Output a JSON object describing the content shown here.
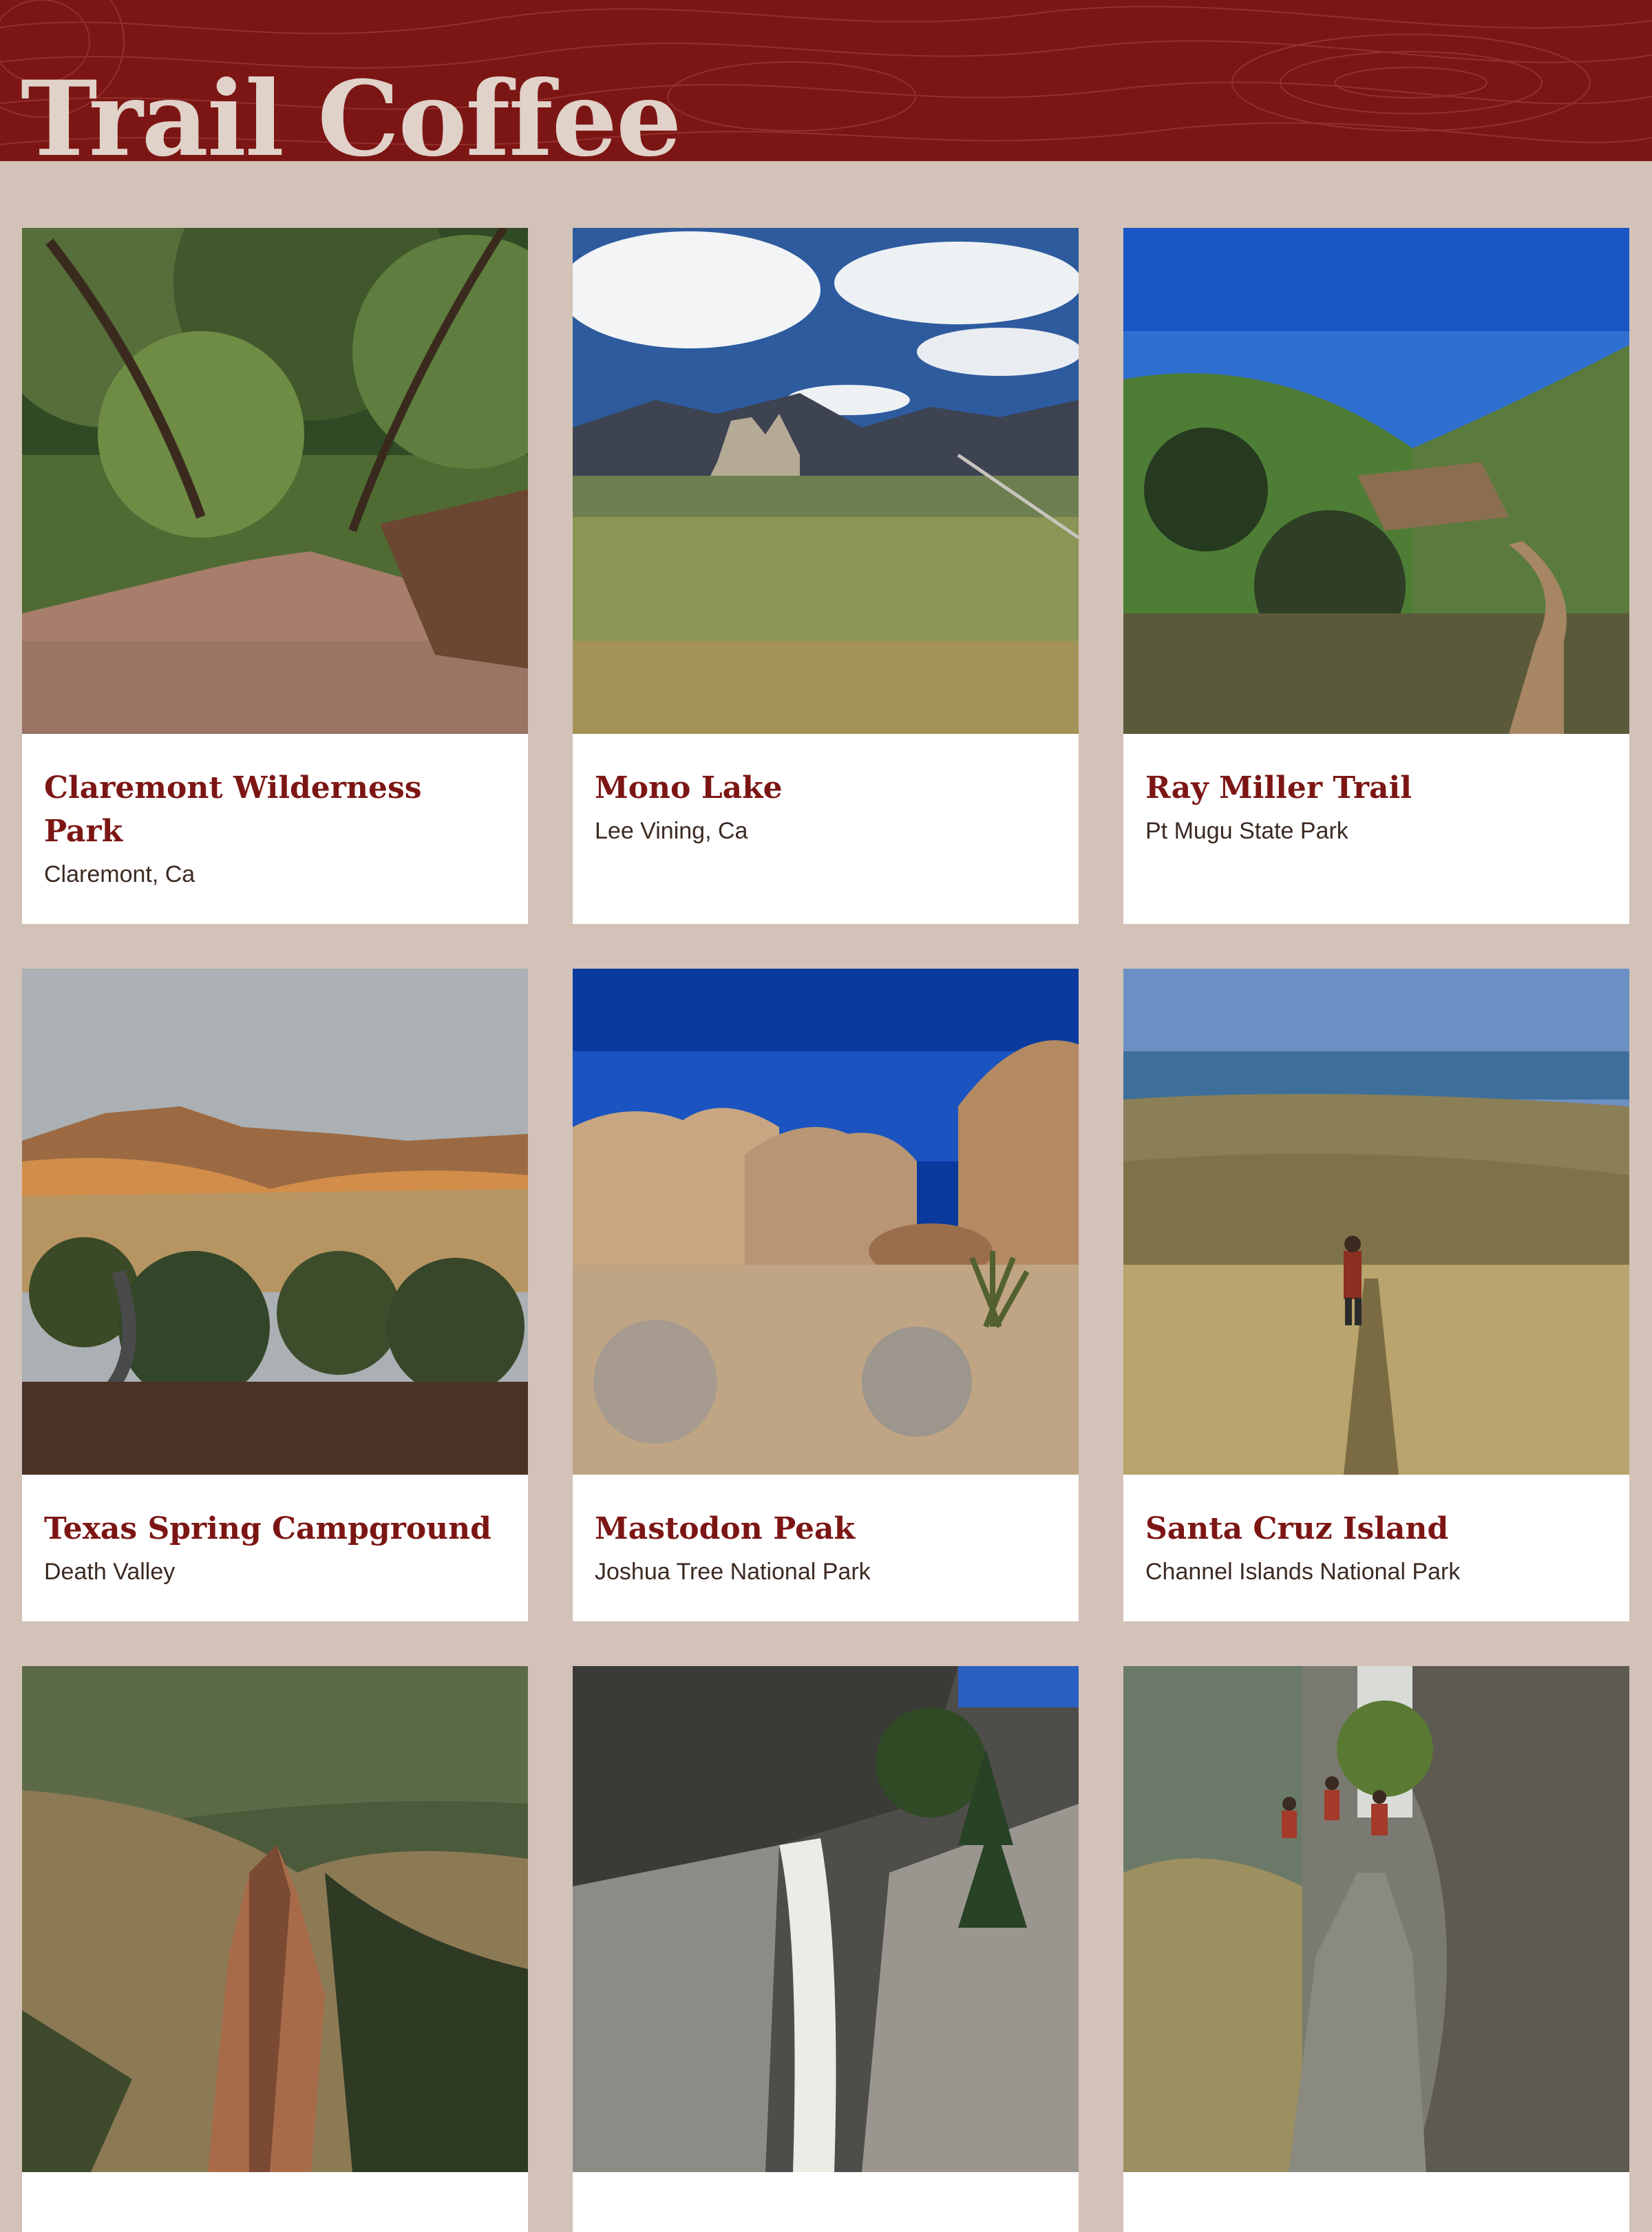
{
  "site": {
    "title": "Trail Coffee"
  },
  "colors": {
    "header_bg": "#7c1614",
    "title_text": "#e0d2c9",
    "page_bg": "#d3c2b8",
    "card_title": "#7c1614"
  },
  "cards": [
    {
      "title": "Claremont Wilderness Park",
      "subtitle": "Claremont, Ca",
      "photo": "oak-tree-dirt-trail"
    },
    {
      "title": "Mono Lake",
      "subtitle": "Lee Vining, Ca",
      "photo": "lake-tufa-mountains-clouds"
    },
    {
      "title": "Ray Miller Trail",
      "subtitle": "Pt Mugu State Park",
      "photo": "green-hills-canyon-trail"
    },
    {
      "title": "Texas Spring Campground",
      "subtitle": "Death Valley",
      "photo": "desert-mountains-sunset"
    },
    {
      "title": "Mastodon Peak",
      "subtitle": "Joshua Tree National Park",
      "photo": "boulders-yucca-blue-sky"
    },
    {
      "title": "Santa Cruz Island",
      "subtitle": "Channel Islands National Park",
      "photo": "grassland-hiker-ocean"
    },
    {
      "title": "",
      "subtitle": "",
      "photo": "canyon-rock-spire"
    },
    {
      "title": "",
      "subtitle": "",
      "photo": "waterfall-granite-cliffs"
    },
    {
      "title": "",
      "subtitle": "",
      "photo": "hikers-stone-stairs-waterfall"
    }
  ]
}
